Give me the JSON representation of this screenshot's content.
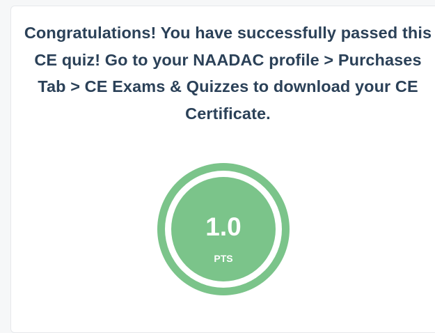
{
  "result": {
    "message": "Congratulations! You have successfully passed this CE quiz! Go to your NAADAC profile > Purchases Tab > CE Exams & Quizzes to download your CE Certificate.",
    "points_value": "1.0",
    "points_unit": "PTS"
  },
  "colors": {
    "heading_text": "#2b4158",
    "badge_green": "#7bc48a",
    "badge_text": "#ffffff"
  }
}
